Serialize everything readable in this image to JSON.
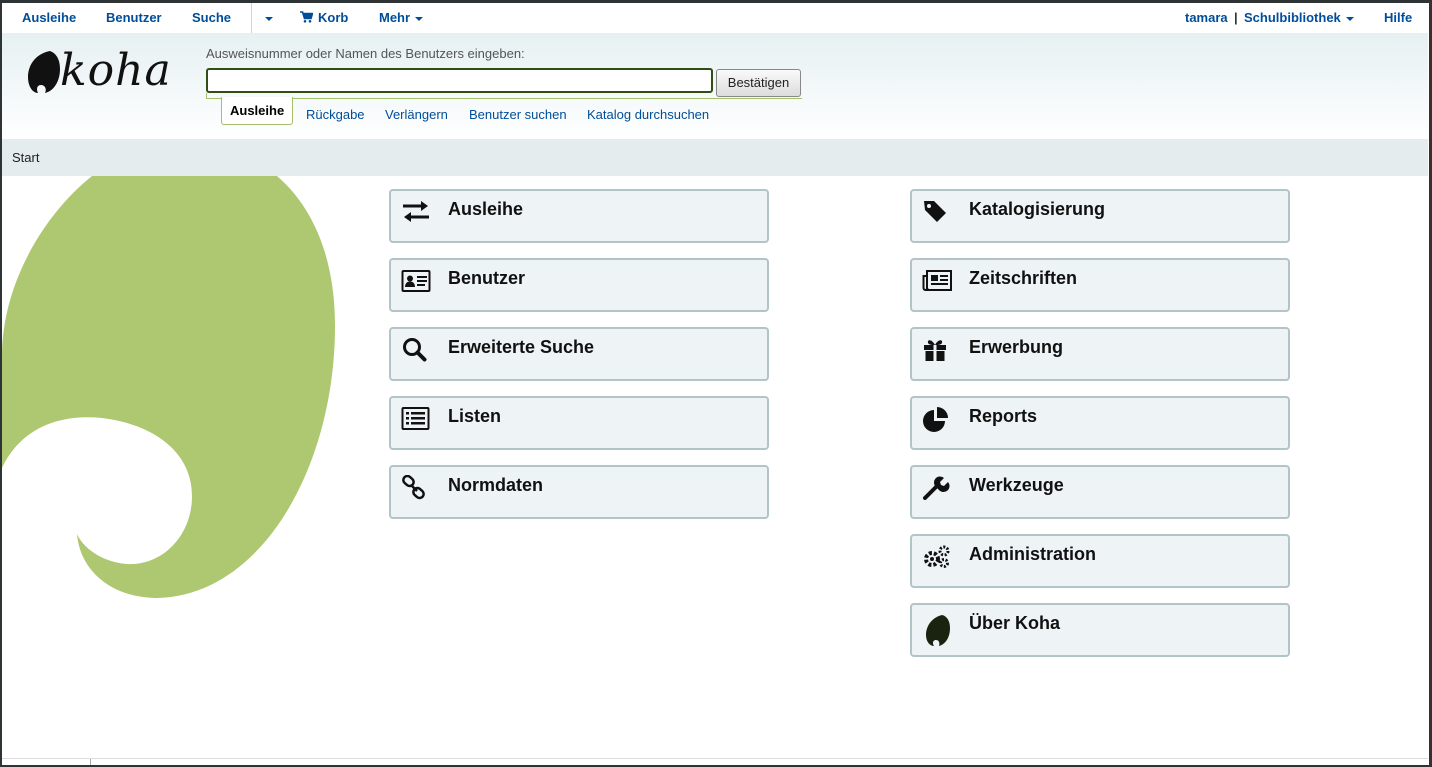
{
  "topnav": {
    "items": [
      "Ausleihe",
      "Benutzer",
      "Suche",
      "Korb",
      "Mehr"
    ],
    "user": "tamara",
    "separator": "|",
    "library": "Schulbibliothek",
    "help": "Hilfe"
  },
  "header": {
    "logo_text": "koha",
    "search_label": "Ausweisnummer oder Namen des Benutzers eingeben:",
    "search_value": "",
    "submit_label": "Bestätigen",
    "tabs": [
      "Ausleihe",
      "Rückgabe",
      "Verlängern",
      "Benutzer suchen",
      "Katalog durchsuchen"
    ]
  },
  "breadcrumb": {
    "home": "Start"
  },
  "modules": {
    "left": [
      {
        "label": "Ausleihe",
        "icon": "exchange-icon"
      },
      {
        "label": "Benutzer",
        "icon": "id-card-icon"
      },
      {
        "label": "Erweiterte Suche",
        "icon": "search-icon"
      },
      {
        "label": "Listen",
        "icon": "list-icon"
      },
      {
        "label": "Normdaten",
        "icon": "link-icon"
      }
    ],
    "right": [
      {
        "label": "Katalogisierung",
        "icon": "tag-icon"
      },
      {
        "label": "Zeitschriften",
        "icon": "newspaper-icon"
      },
      {
        "label": "Erwerbung",
        "icon": "gift-icon"
      },
      {
        "label": "Reports",
        "icon": "pie-chart-icon"
      },
      {
        "label": "Werkzeuge",
        "icon": "wrench-icon"
      },
      {
        "label": "Administration",
        "icon": "gears-icon"
      },
      {
        "label": "Über Koha",
        "icon": "koha-logo-icon"
      }
    ]
  },
  "colors": {
    "link": "#004d99",
    "accent_green": "#a4c069",
    "swirl_green": "#adc870",
    "tile_bg": "#eef4f6",
    "tile_border": "#b3c4c9",
    "breadcrumb_bg": "#e4ecee"
  }
}
